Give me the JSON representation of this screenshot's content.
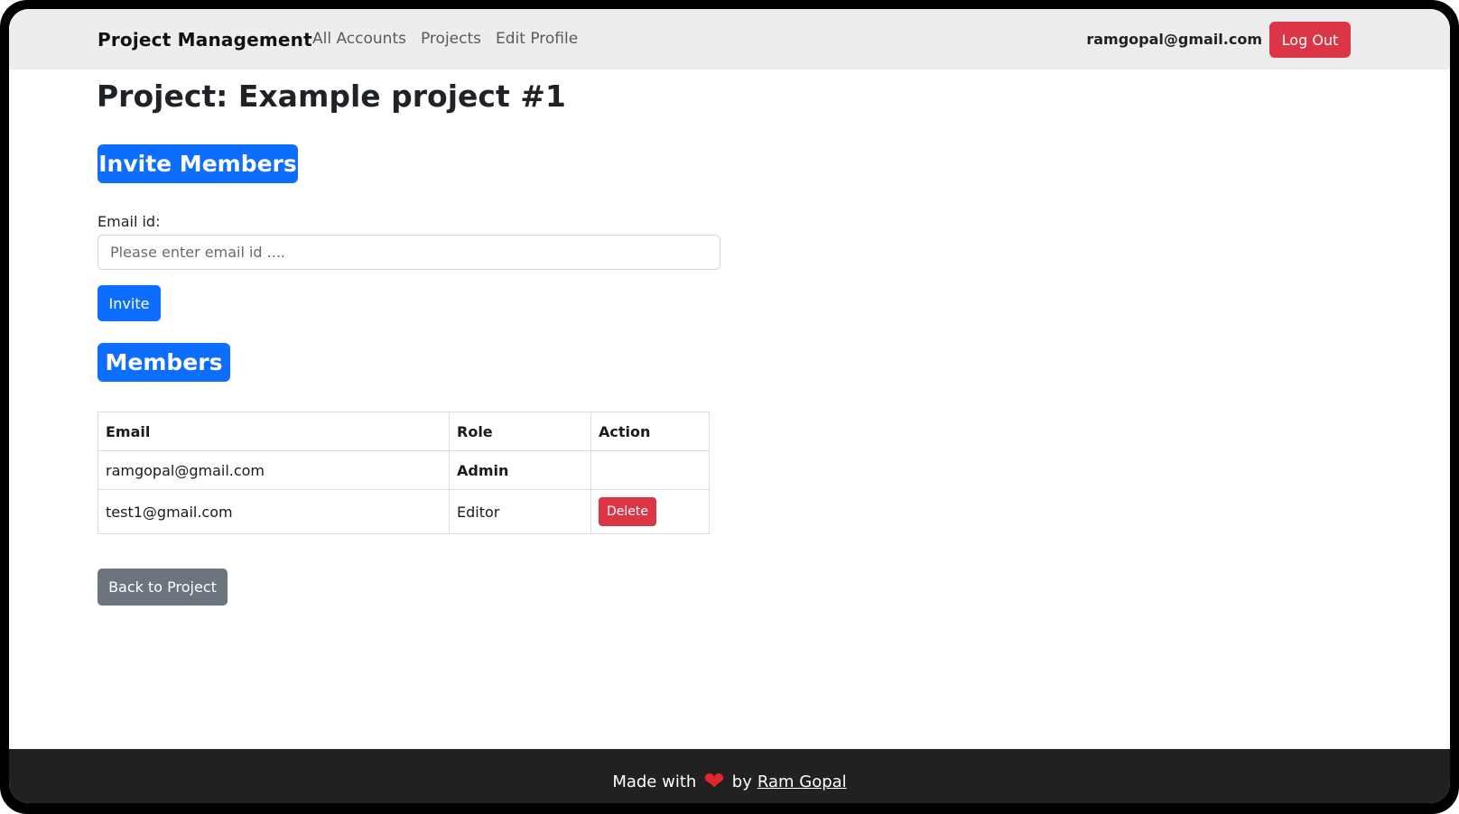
{
  "navbar": {
    "brand": "Project Management",
    "links": [
      {
        "label": "All Accounts"
      },
      {
        "label": "Projects"
      },
      {
        "label": "Edit Profile"
      }
    ],
    "user_email": "ramgopal@gmail.com",
    "logout_label": "Log Out"
  },
  "page": {
    "title": "Project: Example project #1"
  },
  "invite": {
    "heading": "Invite Members",
    "email_label": "Email id:",
    "email_value": "",
    "email_placeholder": "Please enter email id ....",
    "invite_label": "Invite"
  },
  "members": {
    "heading": "Members",
    "columns": [
      "Email",
      "Role",
      "Action"
    ],
    "rows": [
      {
        "email": "ramgopal@gmail.com",
        "role": "Admin",
        "action": ""
      },
      {
        "email": "test1@gmail.com",
        "role": "Editor",
        "action": "Delete"
      }
    ],
    "back_label": "Back to Project"
  },
  "footer": {
    "made_with": "Made with",
    "heart_icon": "heart-icon",
    "by": "by",
    "author": "Ram Gopal"
  },
  "colors": {
    "primary": "#0d6efd",
    "danger": "#dc3545",
    "secondary": "#6c757d",
    "navbar_bg": "#ededed",
    "footer_bg": "#212121"
  }
}
